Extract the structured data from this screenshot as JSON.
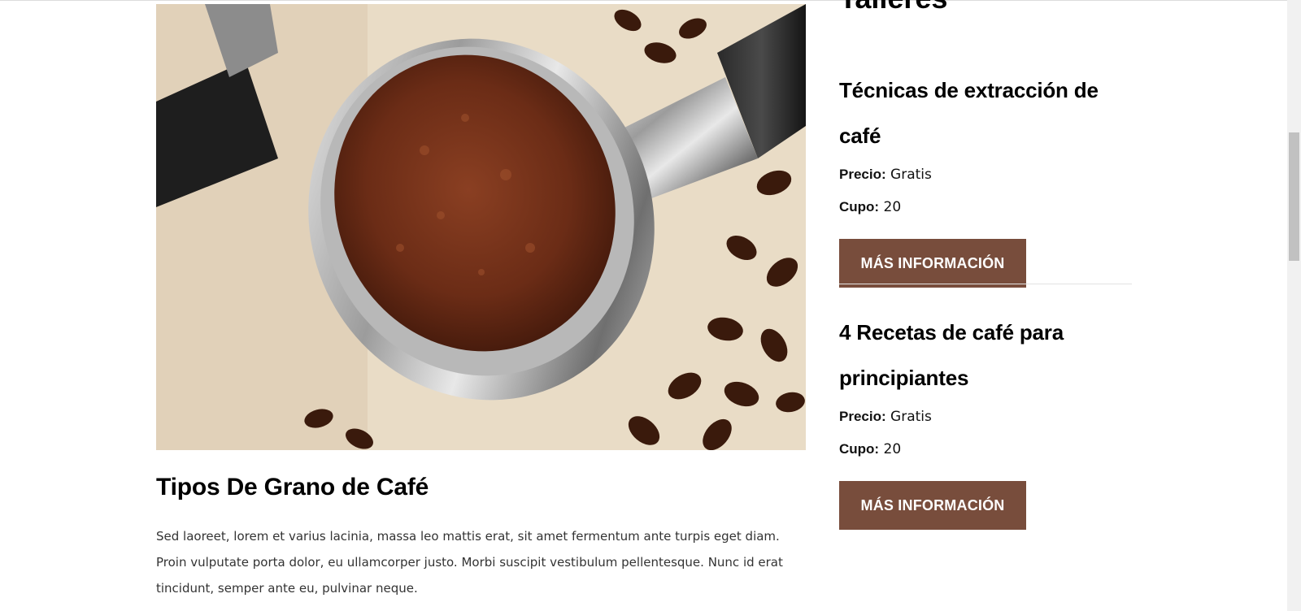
{
  "sidebar": {
    "title": "Talleres",
    "workshops": [
      {
        "title": "Técnicas de extracción de café",
        "price_label": "Precio:",
        "price_value": "Gratis",
        "capacity_label": "Cupo:",
        "capacity_value": "20",
        "button_label": "MÁS INFORMACIÓN"
      },
      {
        "title_line1": "4 Recetas de café para",
        "title_line2": "principiantes",
        "price_label": "Precio:",
        "price_value": "Gratis",
        "capacity_label": "Cupo:",
        "capacity_value": "20",
        "button_label": "MÁS INFORMACIÓN"
      }
    ]
  },
  "article": {
    "title": "Tipos De Grano de Café",
    "body": "Sed laoreet, lorem et varius lacinia, massa leo mattis erat, sit amet fermentum ante turpis eget diam. Proin vulputate porta dolor, eu ullamcorper justo. Morbi suscipit vestibulum pellentesque. Nunc id erat tincidunt, semper ante eu, pulvinar neque."
  },
  "colors": {
    "button_bg": "#784d3c",
    "button_text": "#ffffff"
  },
  "icons": {
    "hero": "espresso-portafilter-photo"
  }
}
